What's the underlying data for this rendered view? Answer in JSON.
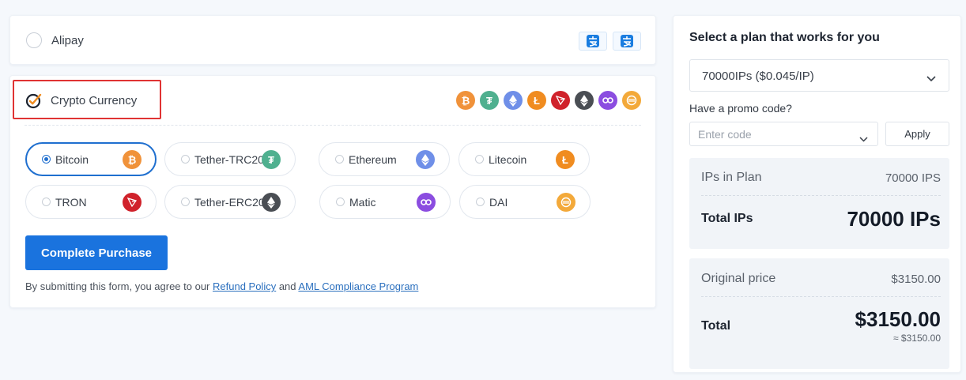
{
  "payment_methods": {
    "alipay": {
      "label": "Alipay"
    },
    "crypto": {
      "label": "Crypto Currency",
      "header_coins": [
        "bitcoin-icon",
        "tether-icon",
        "ethereum-icon",
        "litecoin-icon",
        "tron-icon",
        "ethereum-erc20-icon",
        "matic-icon",
        "dai-icon"
      ],
      "options": [
        {
          "label": "Bitcoin",
          "icon": "bitcoin-icon",
          "selected": true
        },
        {
          "label": "Tether-TRC20",
          "icon": "tether-icon",
          "selected": false
        },
        {
          "label": "Ethereum",
          "icon": "ethereum-icon",
          "selected": false
        },
        {
          "label": "Litecoin",
          "icon": "litecoin-icon",
          "selected": false
        },
        {
          "label": "TRON",
          "icon": "tron-icon",
          "selected": false
        },
        {
          "label": "Tether-ERC20",
          "icon": "ethereum-erc20-icon",
          "selected": false
        },
        {
          "label": "Matic",
          "icon": "matic-icon",
          "selected": false
        },
        {
          "label": "DAI",
          "icon": "dai-icon",
          "selected": false
        }
      ]
    }
  },
  "purchase": {
    "button_label": "Complete Purchase",
    "terms_prefix": "By submitting this form, you agree to our ",
    "refund_link": "Refund Policy",
    "terms_and": " and ",
    "aml_link": "AML Compliance Program"
  },
  "plan": {
    "title": "Select a plan that works for you",
    "selected_plan": "70000IPs ($0.045/IP)",
    "promo_label": "Have a promo code?",
    "promo_placeholder": "Enter code",
    "apply_label": "Apply",
    "ips_in_plan_label": "IPs in Plan",
    "ips_in_plan_value": "70000 IPS",
    "total_ips_label": "Total IPs",
    "total_ips_value": "70000 IPs",
    "original_price_label": "Original price",
    "original_price_value": "$3150.00",
    "total_label": "Total",
    "total_value": "$3150.00",
    "total_approx": "≈ $3150.00"
  },
  "colors": {
    "accent": "#1a73de",
    "highlight_box": "#e03333",
    "bitcoin": "#f0923a",
    "tether": "#4fb08f",
    "ethereum": "#6f8fe8",
    "litecoin": "#f08c20",
    "tron": "#d0222b",
    "ethereum_dark": "#4a4e54",
    "matic": "#8b4de0",
    "dai": "#f3a93a"
  }
}
